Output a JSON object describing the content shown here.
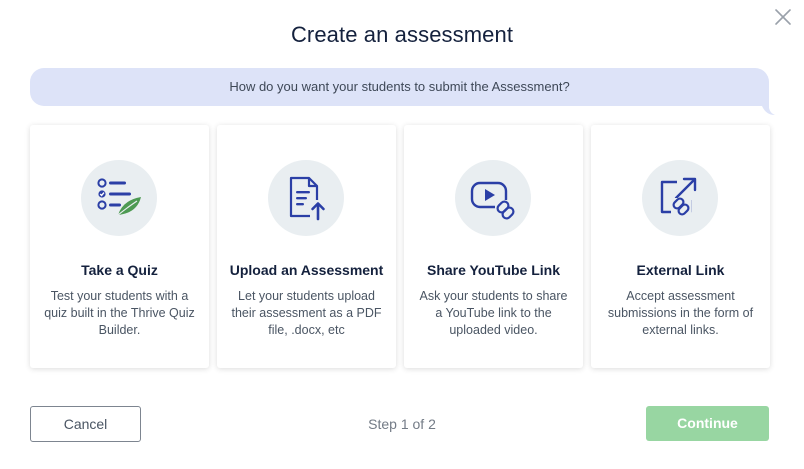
{
  "modal": {
    "title": "Create an assessment",
    "close_icon": "close-icon"
  },
  "prompt": {
    "question": "How do you want your students to submit the Assessment?"
  },
  "options": [
    {
      "title": "Take a Quiz",
      "description": "Test your students with a quiz built in the Thrive Quiz Builder.",
      "icon": "quiz-checklist-icon"
    },
    {
      "title": "Upload an Assessment",
      "description": "Let your students upload their assessment as a PDF file, .docx, etc",
      "icon": "upload-file-icon"
    },
    {
      "title": "Share YouTube Link",
      "description": "Ask your students to share a YouTube link to the uploaded video.",
      "icon": "youtube-link-icon"
    },
    {
      "title": "External Link",
      "description": "Accept assessment submissions in the form of external links.",
      "icon": "external-link-icon"
    }
  ],
  "footer": {
    "cancel_label": "Cancel",
    "step_text": "Step 1 of 2",
    "continue_label": "Continue"
  },
  "colors": {
    "bubble": "#dde3f8",
    "icon_blue": "#2b3fa6",
    "icon_green": "#4d9a52",
    "continue_disabled": "#98d6a2"
  }
}
